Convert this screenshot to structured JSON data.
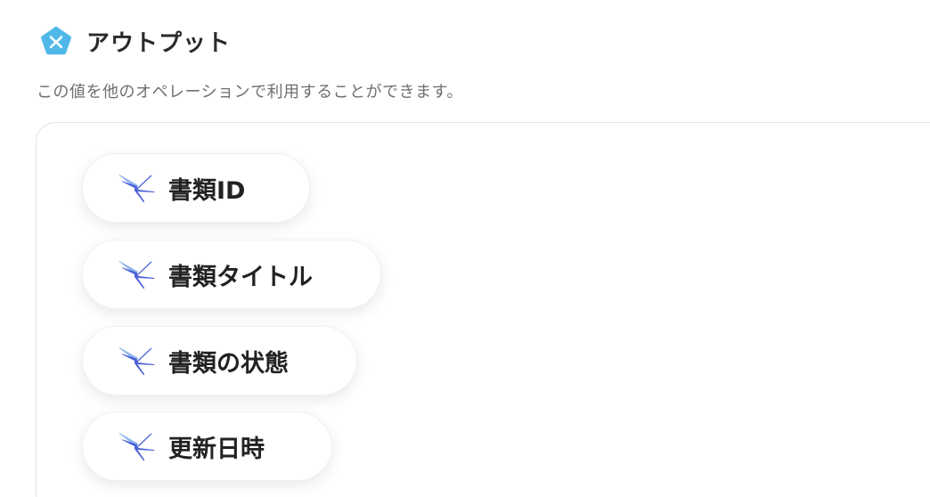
{
  "header": {
    "title": "アウトプット",
    "icon": "yoom-x-pentagon-icon",
    "icon_color": "#4fb8e8"
  },
  "description": "この値を他のオペレーションで利用することができます。",
  "outputs": [
    {
      "label": "書類ID",
      "icon": "dragonfly-icon"
    },
    {
      "label": "書類タイトル",
      "icon": "dragonfly-icon"
    },
    {
      "label": "書類の状態",
      "icon": "dragonfly-icon"
    },
    {
      "label": "更新日時",
      "icon": "dragonfly-icon"
    }
  ],
  "colors": {
    "accent_icon": "#4a5fd6",
    "accent_icon_light": "#8fb4ec",
    "text": "#222222",
    "muted_text": "#6f6f6f",
    "panel_border": "#e3e3e3"
  }
}
